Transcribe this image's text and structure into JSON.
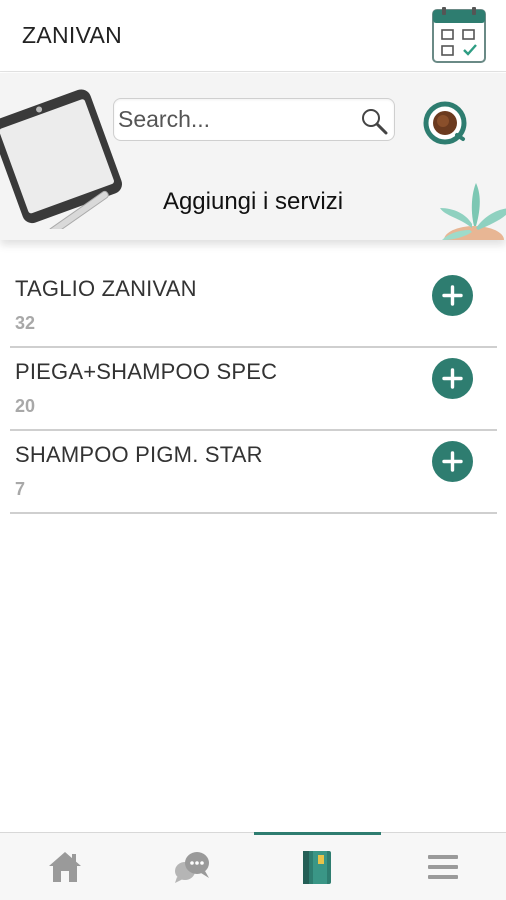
{
  "app": {
    "title": "ZANIVAN"
  },
  "search": {
    "placeholder": "Search..."
  },
  "section": {
    "title": "Aggiungi i servizi"
  },
  "services": [
    {
      "name": "TAGLIO ZANIVAN",
      "count": "32"
    },
    {
      "name": "PIEGA+SHAMPOO SPEC",
      "count": "20"
    },
    {
      "name": "SHAMPOO PIGM. STAR",
      "count": "7"
    }
  ],
  "bottom_nav": {
    "items": [
      {
        "icon": "home-icon"
      },
      {
        "icon": "chat-bubbles-icon"
      },
      {
        "icon": "book-icon",
        "active": true
      },
      {
        "icon": "hamburger-menu-icon"
      }
    ]
  },
  "colors": {
    "accent": "#2e7d70",
    "separator": "#cfcfcf",
    "count_text": "#a8a8a8",
    "icon_gray": "#9a9a9a"
  }
}
